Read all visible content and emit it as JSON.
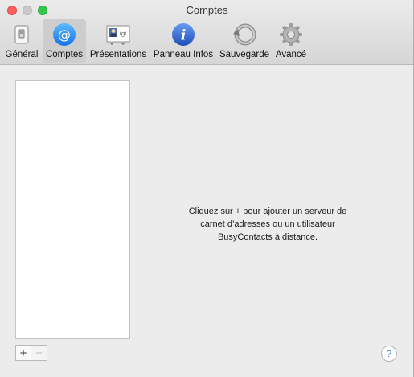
{
  "window": {
    "title": "Comptes"
  },
  "toolbar": {
    "items": [
      {
        "label": "Général",
        "icon": "general-switch-icon",
        "selected": false
      },
      {
        "label": "Comptes",
        "icon": "at-sign-icon",
        "selected": true
      },
      {
        "label": "Présentations",
        "icon": "presentations-card-icon",
        "selected": false
      },
      {
        "label": "Panneau Infos",
        "icon": "info-icon",
        "selected": false
      },
      {
        "label": "Sauvegarde",
        "icon": "backup-arrow-icon",
        "selected": false
      },
      {
        "label": "Avancé",
        "icon": "gear-icon",
        "selected": false
      }
    ]
  },
  "accounts": {
    "empty_hint": "Cliquez sur + pour ajouter un serveur de carnet d’adresses ou un utilisateur BusyContacts à distance.",
    "add_label": "+",
    "remove_label": "−"
  },
  "help": {
    "label": "?"
  },
  "colors": {
    "accent": "#1e88f5",
    "info_blue": "#2f6fd6",
    "close": "#fc605c",
    "maximize": "#34c84a"
  }
}
